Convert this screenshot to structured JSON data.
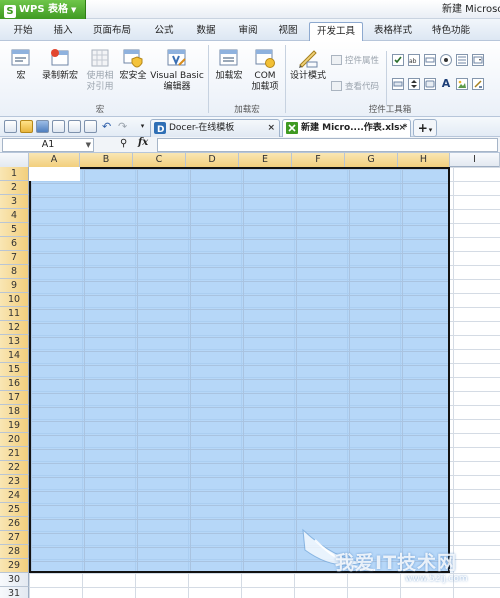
{
  "app": {
    "name": "WPS 表格",
    "logo_letter": "S",
    "window_title": "新建 Microsoft"
  },
  "menu": {
    "tabs": [
      "开始",
      "插入",
      "页面布局",
      "公式",
      "数据",
      "审阅",
      "视图",
      "开发工具",
      "表格样式",
      "特色功能"
    ],
    "active": "开发工具"
  },
  "ribbon": {
    "macro_group": {
      "label": "宏",
      "macro": "宏",
      "record_line1": "录制新宏",
      "relref_line1": "使用相",
      "relref_line2": "对引用",
      "security": "宏安全",
      "vb_line1": "Visual Basic",
      "vb_line2": "编辑器"
    },
    "addin_group": {
      "label": "加载宏",
      "addin": "加载宏",
      "com_line1": "COM",
      "com_line2": "加载项"
    },
    "controls_group": {
      "label": "控件工具箱",
      "design_mode": "设计模式",
      "properties": "控件属性",
      "view_code": "查看代码"
    }
  },
  "tabs": {
    "docer": "Docer-在线模板",
    "workbook": "新建 Micro....作表.xls *",
    "close": "×",
    "add": "+"
  },
  "formula_bar": {
    "cell_ref": "A1",
    "zoom_icon": "magnifier",
    "fx": "fx",
    "value": ""
  },
  "grid": {
    "columns": [
      "A",
      "B",
      "C",
      "D",
      "E",
      "F",
      "G",
      "H",
      "I"
    ],
    "rows": [
      "1",
      "2",
      "3",
      "4",
      "5",
      "6",
      "7",
      "8",
      "9",
      "10",
      "11",
      "12",
      "13",
      "14",
      "15",
      "16",
      "17",
      "18",
      "19",
      "20",
      "21",
      "22",
      "23",
      "24",
      "25",
      "26",
      "27",
      "28",
      "29",
      "30",
      "31"
    ],
    "selected_range": "A1:H29"
  },
  "watermark": {
    "text": "我爱IT技术网",
    "url": "www.52ij.com"
  },
  "colors": {
    "accent_green": "#3f9a22",
    "selection_fill": "#9ec9f5",
    "header_highlight": "#f2cf7d"
  }
}
